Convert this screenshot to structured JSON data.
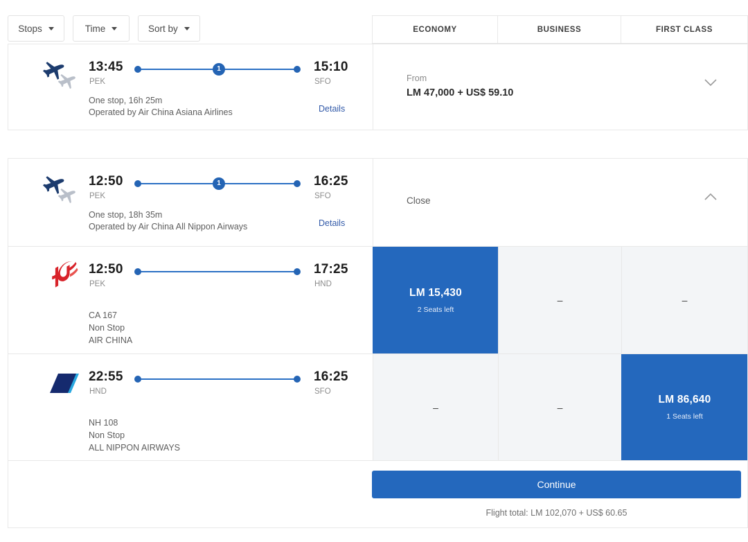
{
  "filters": [
    {
      "label": "Stops",
      "icon": "chevron-down-icon"
    },
    {
      "label": "Time",
      "icon": "chevron-down-icon"
    },
    {
      "label": "Sort by",
      "icon": "chevron-down-icon"
    }
  ],
  "cabin_columns": [
    {
      "label": "ECONOMY"
    },
    {
      "label": "BUSINESS"
    },
    {
      "label": "FIRST CLASS"
    }
  ],
  "colors": {
    "accent_blue": "#2468bd",
    "timeline_blue": "#2464b4",
    "link_blue": "#3159a8",
    "cell_grey": "#f3f5f7",
    "border_grey": "#e8e8e8",
    "air_china_red": "#d8232a",
    "ana_navy": "#152a6e",
    "ana_blue": "#29a8e0"
  },
  "itineraries": [
    {
      "id": "itinerary-1",
      "icon": "two-planes-icon",
      "depart_time": "13:45",
      "depart_code": "PEK",
      "arrive_time": "15:10",
      "arrive_code": "SFO",
      "stops_badge": "1",
      "stops_duration": "One stop, 16h 25m",
      "operated_by": "Operated by Air China Asiana Airlines",
      "details_label": "Details",
      "summary": {
        "from_label": "From",
        "from_price": "LM 47,000 + US$ 59.10",
        "toggle_icon": "chevron-down-icon",
        "expanded": false
      }
    },
    {
      "id": "itinerary-2",
      "icon": "two-planes-icon",
      "depart_time": "12:50",
      "depart_code": "PEK",
      "arrive_time": "16:25",
      "arrive_code": "SFO",
      "stops_badge": "1",
      "stops_duration": "One stop, 18h 35m",
      "operated_by": "Operated by Air China All Nippon Airways",
      "details_label": "Details",
      "summary": {
        "close_label": "Close",
        "toggle_icon": "chevron-up-icon",
        "expanded": true
      },
      "segments": [
        {
          "id": "segment-ca167",
          "logo": "air-china-logo",
          "depart_time": "12:50",
          "depart_code": "PEK",
          "arrive_time": "17:25",
          "arrive_code": "HND",
          "flight_number": "CA 167",
          "stop_type": "Non Stop",
          "airline": "AIR CHINA",
          "fares": [
            {
              "cabin": "ECONOMY",
              "price": "LM 15,430",
              "seats": "2 Seats left",
              "selected": true
            },
            {
              "cabin": "BUSINESS",
              "price": "–",
              "seats": "",
              "selected": false
            },
            {
              "cabin": "FIRST CLASS",
              "price": "–",
              "seats": "",
              "selected": false
            }
          ]
        },
        {
          "id": "segment-nh108",
          "logo": "ana-logo",
          "depart_time": "22:55",
          "depart_code": "HND",
          "arrive_time": "16:25",
          "arrive_code": "SFO",
          "flight_number": "NH 108",
          "stop_type": "Non Stop",
          "airline": "ALL NIPPON AIRWAYS",
          "fares": [
            {
              "cabin": "ECONOMY",
              "price": "–",
              "seats": "",
              "selected": false
            },
            {
              "cabin": "BUSINESS",
              "price": "–",
              "seats": "",
              "selected": false
            },
            {
              "cabin": "FIRST CLASS",
              "price": "LM 86,640",
              "seats": "1 Seats left",
              "selected": true
            }
          ]
        }
      ]
    }
  ],
  "footer": {
    "continue_label": "Continue",
    "flight_total": "Flight total: LM 102,070 + US$ 60.65"
  }
}
